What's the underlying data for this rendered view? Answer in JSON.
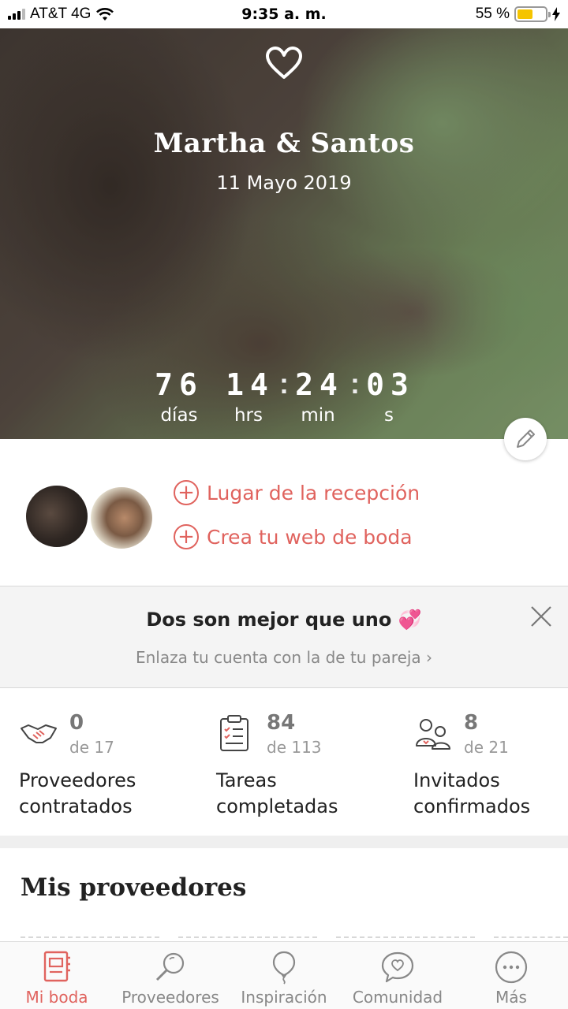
{
  "status_bar": {
    "carrier": "AT&T 4G",
    "time": "9:35 a. m.",
    "battery": "55 %",
    "battery_level": 0.55
  },
  "hero": {
    "couple_names": "Martha & Santos",
    "wedding_date": "11 Mayo 2019",
    "countdown": {
      "days": "76",
      "hours": "14",
      "minutes": "24",
      "seconds": "03",
      "days_label": "días",
      "hours_label": "hrs",
      "minutes_label": "min",
      "seconds_label": "s"
    }
  },
  "profile": {
    "links": {
      "reception": "Lugar de la recepción",
      "website": "Crea tu web de boda"
    }
  },
  "banner": {
    "title": "Dos son mejor que uno 💞",
    "subtitle": "Enlaza tu cuenta con la de tu pareja  ›"
  },
  "stats": [
    {
      "value": "0",
      "of": "de 17",
      "label": "Proveedores contratados",
      "icon": "handshake-icon"
    },
    {
      "value": "84",
      "of": "de 113",
      "label": "Tareas completadas",
      "icon": "checklist-icon"
    },
    {
      "value": "8",
      "of": "de 21",
      "label": "Invitados confirmados",
      "icon": "guests-icon"
    }
  ],
  "section": {
    "title": "Mis proveedores"
  },
  "tabs": [
    {
      "label": "Mi boda",
      "icon": "planner-icon",
      "active": true
    },
    {
      "label": "Proveedores",
      "icon": "search-icon",
      "active": false
    },
    {
      "label": "Inspiración",
      "icon": "balloon-icon",
      "active": false
    },
    {
      "label": "Comunidad",
      "icon": "chat-heart-icon",
      "active": false
    },
    {
      "label": "Más",
      "icon": "more-icon",
      "active": false
    }
  ],
  "colors": {
    "accent": "#e0635e",
    "muted": "#888888"
  }
}
